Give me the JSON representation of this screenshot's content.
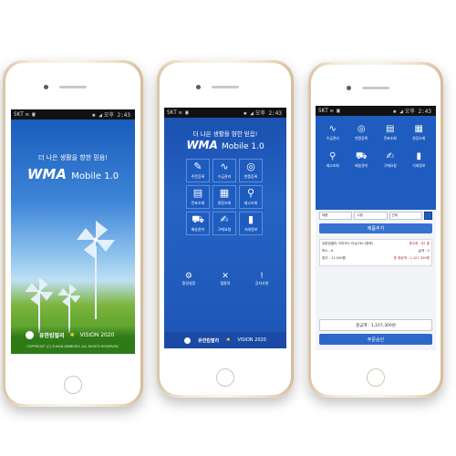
{
  "statusbar": {
    "carrier": "SKT",
    "left_icons": "✉ ▣",
    "right_icons": "✱ ◢",
    "time": "오후 2:43"
  },
  "splash": {
    "slogan": "더 나은 생활을 향한 믿음!",
    "brand": "WMA",
    "brand_sub": "Mobile 1.0",
    "company_logo": "유한킴벌리",
    "vision_logo": "VISION 2020",
    "footer_text": "COPYRIGHT (C) YUHAN-KIMBERLY. ALL RIGHTS RESERVED."
  },
  "main_menu": {
    "slogan": "더 나은 생활을 향한 믿음!",
    "brand": "WMA",
    "brand_sub": "Mobile 1.0",
    "tiles": [
      {
        "icon": "✎",
        "icon_name": "pencil-icon",
        "label": "주문등록"
      },
      {
        "icon": "∿",
        "icon_name": "pulse-icon",
        "label": "수금관리"
      },
      {
        "icon": "◎",
        "icon_name": "headset-icon",
        "label": "반품등록"
      },
      {
        "icon": "▤",
        "icon_name": "book-icon",
        "label": "전표조회"
      },
      {
        "icon": "▦",
        "icon_name": "document-icon",
        "label": "원장조회"
      },
      {
        "icon": "⚲",
        "icon_name": "magnifier-icon",
        "label": "재고조회"
      },
      {
        "icon": "⛟",
        "icon_name": "cart-icon",
        "label": "배송관리"
      },
      {
        "icon": "✍",
        "icon_name": "signature-icon",
        "label": "구매요청"
      },
      {
        "icon": "▮",
        "icon_name": "bar-chart-icon",
        "label": "거래정보"
      }
    ],
    "bottom": [
      {
        "icon": "⚙",
        "icon_name": "gear-icon",
        "label": "환경설정"
      },
      {
        "icon": "✕",
        "icon_name": "close-icon",
        "label": "앱종료"
      },
      {
        "icon": "!",
        "icon_name": "notice-icon",
        "label": "공지사항"
      }
    ],
    "company_logo": "유한킴벌리",
    "vision_logo": "VISION 2020"
  },
  "order": {
    "menu": [
      {
        "icon": "∿",
        "icon_name": "pulse-icon",
        "label": "수금관리"
      },
      {
        "icon": "◎",
        "icon_name": "headset-icon",
        "label": "반품등록"
      },
      {
        "icon": "▤",
        "icon_name": "book-icon",
        "label": "전표조회"
      },
      {
        "icon": "▦",
        "icon_name": "document-icon",
        "label": "원장조회"
      },
      {
        "icon": "⚲",
        "icon_name": "magnifier-icon",
        "label": "재고조회"
      },
      {
        "icon": "⛟",
        "icon_name": "cart-icon",
        "label": "배송관리"
      },
      {
        "icon": "✍",
        "icon_name": "signature-icon",
        "label": "구매요청"
      },
      {
        "icon": "▮",
        "icon_name": "bar-chart-icon",
        "label": "거래정보"
      }
    ],
    "search_fields": [
      "제품",
      "수량",
      "단위",
      ""
    ],
    "add_button": "제품추가",
    "item": {
      "name": "유한킴벌리 크리넥스 티슈230 (중략)",
      "qty_label": "총수량 : 62 통",
      "unit": "박스 : 6",
      "each": "낱개 : 2",
      "price": "정가 : 11,500원",
      "amount": "총 제공액 : 1,107,300원"
    },
    "total": "총금액 : 1,107,300원",
    "order_button": "주문승인"
  },
  "colors": {
    "splash_blue": "#1557b8",
    "menu_blue": "#1f5cbf",
    "grass_green": "#3d8e1c",
    "gold_frame": "#efe0c7"
  }
}
